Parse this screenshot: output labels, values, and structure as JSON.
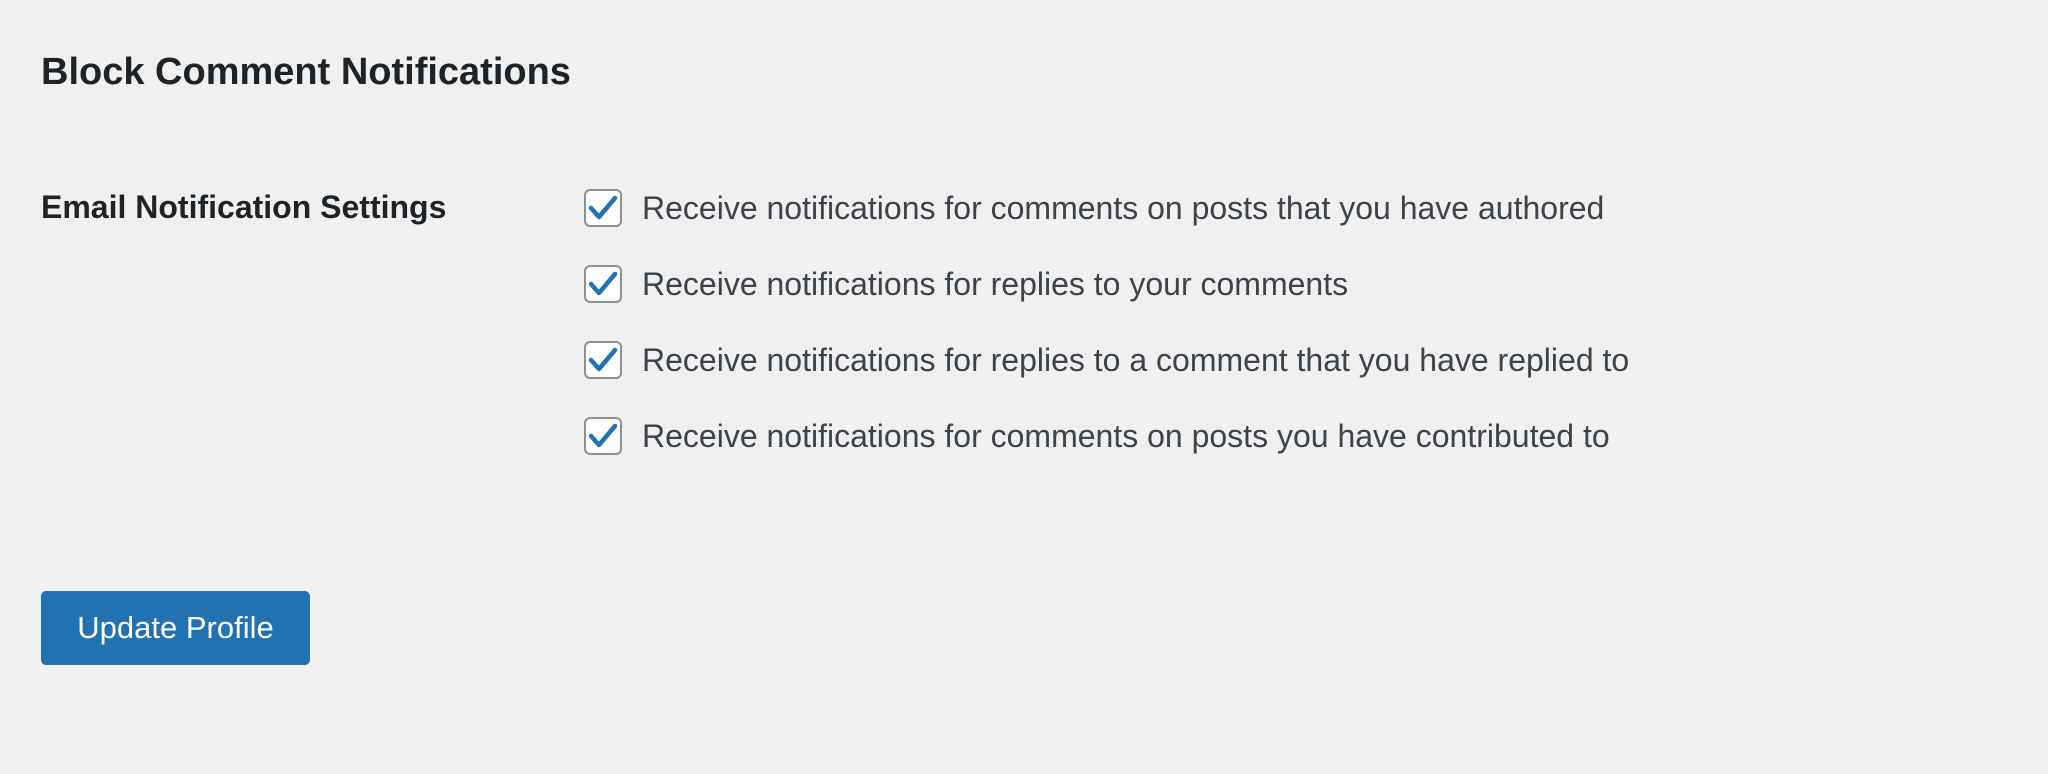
{
  "section": {
    "title": "Block Comment Notifications"
  },
  "email_settings": {
    "label": "Email Notification Settings",
    "options": [
      {
        "label": "Receive notifications for comments on posts that you have authored",
        "checked": true
      },
      {
        "label": "Receive notifications for replies to your comments",
        "checked": true
      },
      {
        "label": "Receive notifications for replies to a comment that you have replied to",
        "checked": true
      },
      {
        "label": "Receive notifications for comments on posts you have contributed to",
        "checked": true
      }
    ]
  },
  "actions": {
    "submit_label": "Update Profile"
  },
  "colors": {
    "background": "#f0f0f1",
    "accent": "#2271b1",
    "check": "#2271b1",
    "text": "#1d2327",
    "muted_text": "#3c434a",
    "checkbox_border": "#8c8f94"
  },
  "icons": {
    "checkmark": "checkmark-icon"
  }
}
